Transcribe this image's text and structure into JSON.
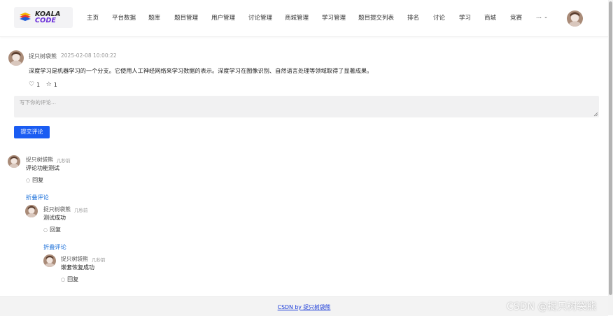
{
  "header": {
    "logo": {
      "line1": "KOALA",
      "line2": "CODE"
    },
    "nav": [
      "主页",
      "平台数据",
      "题库",
      "题目管理",
      "用户管理",
      "讨论管理",
      "商城管理",
      "学习管理",
      "题目提交列表",
      "排名",
      "讨论",
      "学习",
      "商城",
      "竞赛"
    ],
    "more_label": "..."
  },
  "post": {
    "author": "捉只树袋熊",
    "time": "2025-02-08 10:00:22",
    "content": "深度学习是机器学习的一个分支。它使用人工神经网络来学习数据的表示。深度学习在图像识别、自然语言处理等领域取得了显著成果。",
    "likes": "1",
    "stars": "1"
  },
  "comment_form": {
    "placeholder": "写下你的评论...",
    "submit_label": "提交评论"
  },
  "comments": [
    {
      "author": "捉只树袋熊",
      "time": "几秒前",
      "text": "评论功能测试",
      "reply_label": "回复",
      "fold_label": "折叠评论"
    },
    {
      "author": "捉只树袋熊",
      "time": "几秒前",
      "text": "测试成功",
      "reply_label": "回复",
      "fold_label": "折叠评论"
    },
    {
      "author": "捉只树袋熊",
      "time": "几秒前",
      "text": "嵌套恢复成功",
      "reply_label": "回复"
    }
  ],
  "footer": {
    "link": "CSDN by 捉只树袋熊"
  },
  "watermark": "CSDN @捉只树袋熊",
  "colors": {
    "accent": "#1a5cf2",
    "fold_link": "#1a6fd9",
    "footer_link": "#1a3bd9"
  }
}
